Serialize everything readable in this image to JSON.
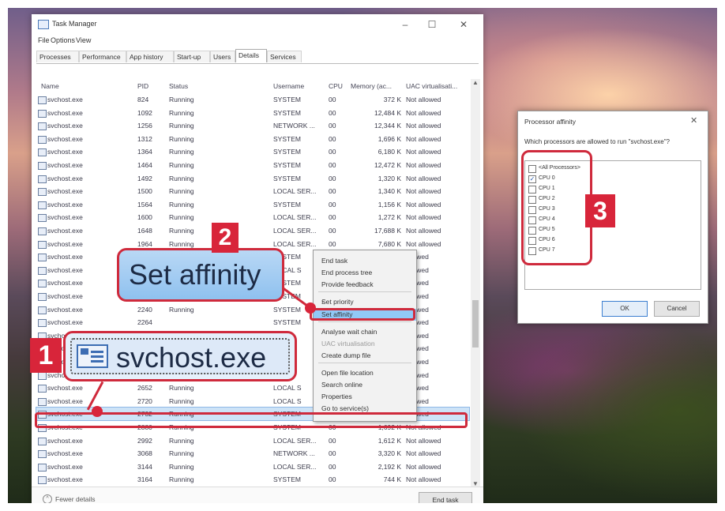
{
  "window": {
    "title": "Task Manager",
    "minimize": "–",
    "maximize": "☐",
    "close": "✕"
  },
  "menu": [
    "File",
    "Options",
    "View"
  ],
  "tabs": [
    "Processes",
    "Performance",
    "App history",
    "Start-up",
    "Users",
    "Details",
    "Services"
  ],
  "columns": [
    "Name",
    "PID",
    "Status",
    "Username",
    "CPU",
    "Memory (ac...",
    "UAC virtualisati..."
  ],
  "rows": [
    [
      "svchost.exe",
      "824",
      "Running",
      "SYSTEM",
      "00",
      "372 K",
      "Not allowed"
    ],
    [
      "svchost.exe",
      "1092",
      "Running",
      "SYSTEM",
      "00",
      "12,484 K",
      "Not allowed"
    ],
    [
      "svchost.exe",
      "1256",
      "Running",
      "NETWORK ...",
      "00",
      "12,344 K",
      "Not allowed"
    ],
    [
      "svchost.exe",
      "1312",
      "Running",
      "SYSTEM",
      "00",
      "1,696 K",
      "Not allowed"
    ],
    [
      "svchost.exe",
      "1364",
      "Running",
      "SYSTEM",
      "00",
      "6,180 K",
      "Not allowed"
    ],
    [
      "svchost.exe",
      "1464",
      "Running",
      "SYSTEM",
      "00",
      "12,472 K",
      "Not allowed"
    ],
    [
      "svchost.exe",
      "1492",
      "Running",
      "SYSTEM",
      "00",
      "1,320 K",
      "Not allowed"
    ],
    [
      "svchost.exe",
      "1500",
      "Running",
      "LOCAL SER...",
      "00",
      "1,340 K",
      "Not allowed"
    ],
    [
      "svchost.exe",
      "1564",
      "Running",
      "SYSTEM",
      "00",
      "1,156 K",
      "Not allowed"
    ],
    [
      "svchost.exe",
      "1600",
      "Running",
      "LOCAL SER...",
      "00",
      "1,272 K",
      "Not allowed"
    ],
    [
      "svchost.exe",
      "1648",
      "Running",
      "LOCAL SER...",
      "00",
      "17,688 K",
      "Not allowed"
    ],
    [
      "svchost.exe",
      "1964",
      "Running",
      "LOCAL SER...",
      "00",
      "7,680 K",
      "Not allowed"
    ],
    [
      "svchost.exe",
      "",
      "",
      "SYSTEM",
      "",
      "",
      "allowed"
    ],
    [
      "svchost.exe",
      "",
      "",
      "LOCAL S",
      "",
      "",
      "allowed"
    ],
    [
      "svchost.exe",
      "",
      "",
      "SYSTEM",
      "",
      "",
      "allowed"
    ],
    [
      "svchost.exe",
      "2148",
      "Running",
      "SYSTEM",
      "",
      "",
      "allowed"
    ],
    [
      "svchost.exe",
      "2240",
      "Running",
      "SYSTEM",
      "",
      "",
      "allowed"
    ],
    [
      "svchost.exe",
      "2264",
      "",
      "SYSTEM",
      "",
      "",
      "allowed"
    ],
    [
      "svchost.exe",
      "",
      "",
      "",
      "",
      "",
      "allowed"
    ],
    [
      "svchost.exe",
      "",
      "",
      "",
      "",
      "",
      "allowed"
    ],
    [
      "svchost.exe",
      "",
      "",
      "",
      "",
      "",
      "allowed"
    ],
    [
      "svchost.exe",
      "",
      "",
      "",
      "",
      "",
      "allowed"
    ],
    [
      "svchost.exe",
      "2652",
      "Running",
      "LOCAL S",
      "",
      "",
      "allowed"
    ],
    [
      "svchost.exe",
      "2720",
      "Running",
      "LOCAL S",
      "",
      "",
      "allowed"
    ],
    [
      "svchost.exe",
      "2732",
      "Running",
      "SYSTEM",
      "",
      "",
      "allowed"
    ],
    [
      "svchost.exe",
      "2880",
      "Running",
      "SYSTEM",
      "00",
      "1,692 K",
      "Not allowed"
    ],
    [
      "svchost.exe",
      "2992",
      "Running",
      "LOCAL SER...",
      "00",
      "1,612 K",
      "Not allowed"
    ],
    [
      "svchost.exe",
      "3068",
      "Running",
      "NETWORK ...",
      "00",
      "3,320 K",
      "Not allowed"
    ],
    [
      "svchost.exe",
      "3144",
      "Running",
      "LOCAL SER...",
      "00",
      "2,192 K",
      "Not allowed"
    ],
    [
      "svchost.exe",
      "3164",
      "Running",
      "SYSTEM",
      "00",
      "744 K",
      "Not allowed"
    ]
  ],
  "footer": {
    "fewer_details": "Fewer details",
    "end_task": "End task"
  },
  "context_menu": {
    "items": [
      "End task",
      "End process tree",
      "Provide feedback",
      "Set priority",
      "Set affinity",
      "Analyse wait chain",
      "UAC virtualisation",
      "Create dump file",
      "Open file location",
      "Search online",
      "Properties",
      "Go to service(s)"
    ],
    "submenu_arrow": "›"
  },
  "affinity_dialog": {
    "title": "Processor affinity",
    "close": "✕",
    "question": "Which processors are allowed to run \"svchost.exe\"?",
    "options": [
      "<All Processors>",
      "CPU 0",
      "CPU 1",
      "CPU 2",
      "CPU 3",
      "CPU 4",
      "CPU 5",
      "CPU 6",
      "CPU 7"
    ],
    "checked": [
      false,
      true,
      false,
      false,
      false,
      false,
      false,
      false,
      false
    ],
    "check_mark": "✓",
    "ok": "OK",
    "cancel": "Cancel"
  },
  "callouts": {
    "step1": "1",
    "step2": "2",
    "step3": "3",
    "zoom_process": "svchost.exe",
    "zoom_action": "Set affinity"
  },
  "colors": {
    "accent_red": "#d8253a",
    "selection_blue": "#cde3f7",
    "menu_highlight": "#91c9f7"
  }
}
